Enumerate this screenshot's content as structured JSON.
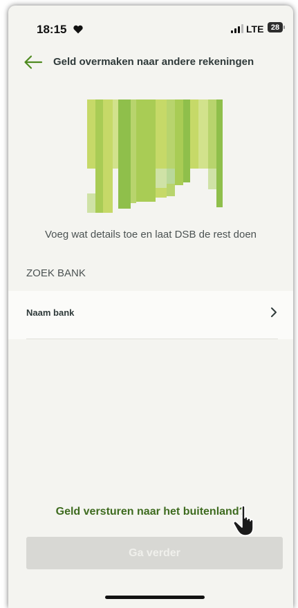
{
  "status_bar": {
    "time": "18:15",
    "network": "LTE",
    "battery": "28",
    "icons": [
      "heart-icon",
      "signal-icon",
      "battery-icon"
    ]
  },
  "header": {
    "title": "Geld overmaken naar andere rekeningen",
    "back_icon": "arrow-left-icon"
  },
  "illustration": {
    "colors": [
      "#c6d968",
      "#a9cc55",
      "#8fbf4b",
      "#d2e28c",
      "#b8d46d",
      "#cfe2a6"
    ]
  },
  "main": {
    "intro_text": "Voeg wat details toe en laat DSB de rest doen",
    "section_label": "ZOEK BANK",
    "bank_row_label": "Naam bank",
    "chevron_icon": "chevron-right-icon"
  },
  "footer": {
    "abroad_link": "Geld versturen naar het buitenland?",
    "continue_label": "Ga verder"
  },
  "colors": {
    "accent": "#4e8a1f",
    "link": "#3e6b1f",
    "background": "#f4f4f0",
    "button_disabled": "#d8d8d4"
  }
}
